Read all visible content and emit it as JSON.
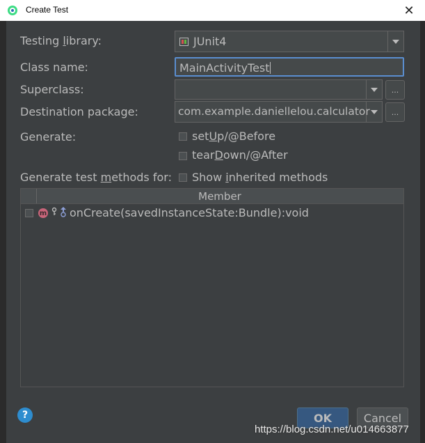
{
  "window": {
    "title": "Create Test"
  },
  "form": {
    "testing_library": {
      "label_pre": "Testing ",
      "label_u": "l",
      "label_post": "ibrary:",
      "value": "JUnit4"
    },
    "class_name": {
      "label": "Class name:",
      "value": "MainActivityTest"
    },
    "superclass": {
      "label": "Superclass:",
      "value": "",
      "browse": "..."
    },
    "destination": {
      "label": "Destination package:",
      "value": "com.example.daniellelou.calculator",
      "browse": "..."
    },
    "generate": {
      "label": "Generate:",
      "setup_pre": "set",
      "setup_u": "U",
      "setup_post": "p/@Before",
      "teardown_pre": "tear",
      "teardown_u": "D",
      "teardown_post": "own/@After"
    },
    "methods_for": {
      "label_pre": "Generate test ",
      "label_u": "m",
      "label_post": "ethods for:",
      "inherited_pre": "Show ",
      "inherited_u": "i",
      "inherited_post": "nherited methods"
    }
  },
  "table": {
    "header": "Member",
    "rows": [
      {
        "badge": "m",
        "text": "onCreate(savedInstanceState:Bundle):void"
      }
    ]
  },
  "buttons": {
    "help": "?",
    "ok": "OK",
    "cancel": "Cancel"
  },
  "watermark": "https://blog.csdn.net/u014663877",
  "colors": {
    "accent": "#365880",
    "focus": "#5a8ed0",
    "background": "#3c3f41",
    "text": "#bbbbbb"
  }
}
